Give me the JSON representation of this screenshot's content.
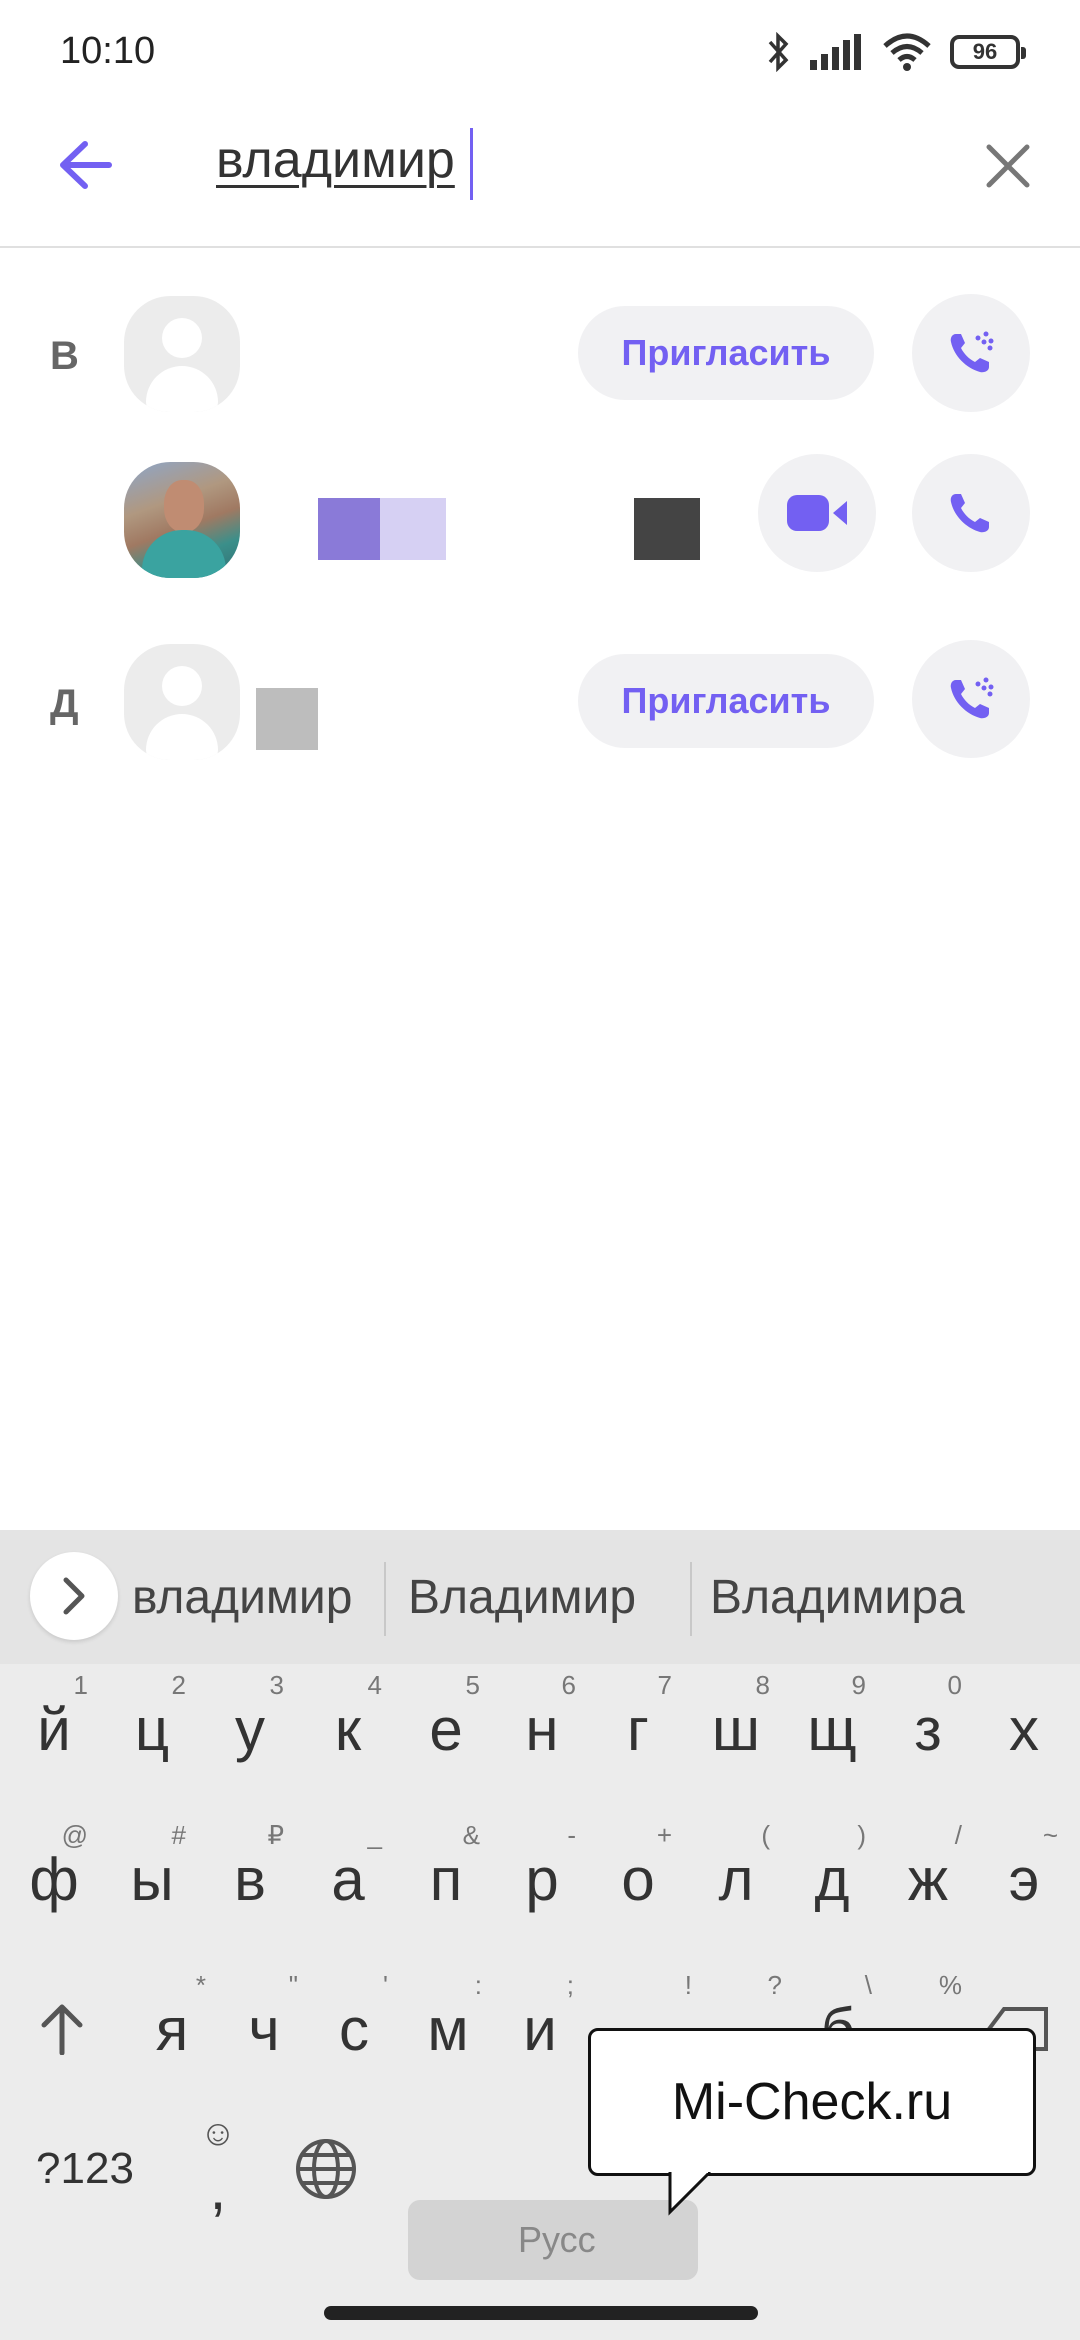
{
  "status_bar": {
    "time": "10:10",
    "battery": "96",
    "icons": [
      "bluetooth-icon",
      "signal-icon",
      "wifi-icon",
      "battery-icon"
    ]
  },
  "search": {
    "query": "владимир",
    "back_icon": "arrow-left-icon",
    "clear_icon": "close-icon"
  },
  "contacts": [
    {
      "section": "В",
      "avatar": "default",
      "action": "Пригласить",
      "call": "viber-out-call-icon"
    },
    {
      "section": "",
      "avatar": "photo",
      "video": "video-call-icon",
      "call": "phone-icon"
    },
    {
      "section": "Д",
      "avatar": "default",
      "action": "Пригласить",
      "call": "viber-out-call-icon"
    }
  ],
  "suggestions": [
    "владимир",
    "Владимир",
    "Владимира"
  ],
  "keyboard": {
    "row1": [
      {
        "k": "й",
        "h": "1"
      },
      {
        "k": "ц",
        "h": "2"
      },
      {
        "k": "у",
        "h": "3"
      },
      {
        "k": "к",
        "h": "4"
      },
      {
        "k": "е",
        "h": "5"
      },
      {
        "k": "н",
        "h": "6"
      },
      {
        "k": "г",
        "h": "7"
      },
      {
        "k": "ш",
        "h": "8"
      },
      {
        "k": "щ",
        "h": "9"
      },
      {
        "k": "з",
        "h": "0"
      },
      {
        "k": "х",
        "h": ""
      }
    ],
    "row2": [
      {
        "k": "ф",
        "h": "@"
      },
      {
        "k": "ы",
        "h": "#"
      },
      {
        "k": "в",
        "h": "₽"
      },
      {
        "k": "а",
        "h": "_"
      },
      {
        "k": "п",
        "h": "&"
      },
      {
        "k": "р",
        "h": "-"
      },
      {
        "k": "о",
        "h": "+"
      },
      {
        "k": "л",
        "h": "("
      },
      {
        "k": "д",
        "h": ")"
      },
      {
        "k": "ж",
        "h": "/"
      },
      {
        "k": "э",
        "h": "~"
      }
    ],
    "row3": [
      {
        "k": "я",
        "h": "*"
      },
      {
        "k": "ч",
        "h": "\""
      },
      {
        "k": "с",
        "h": "'"
      },
      {
        "k": "м",
        "h": ":"
      },
      {
        "k": "и",
        "h": ";"
      },
      {
        "k": "",
        "h": "!"
      },
      {
        "k": "",
        "h": "?"
      },
      {
        "k": "б",
        "h": "\\"
      },
      {
        "k": "",
        "h": "%"
      }
    ],
    "numbers_key": "?123",
    "emoji_comma": ",",
    "space_label": "Русс",
    "shift_icon": "shift-arrow-icon",
    "globe_icon": "globe-icon",
    "backspace_icon": "backspace-icon"
  },
  "watermark": "Mi-Check.ru",
  "colors": {
    "accent": "#7360f2",
    "button_bg": "#f1f1f3",
    "keyboard_bg": "#ececec"
  }
}
